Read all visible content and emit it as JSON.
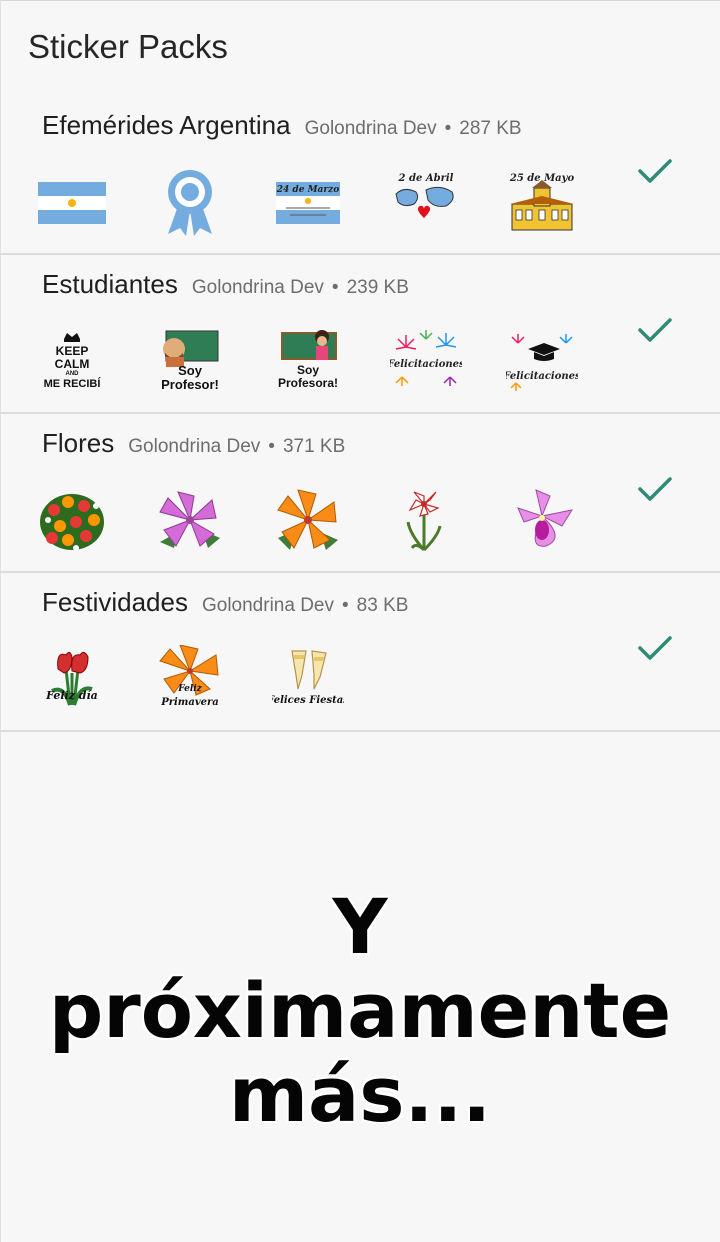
{
  "app": {
    "title": "Sticker Packs"
  },
  "packs": [
    {
      "name": "Efemérides Argentina",
      "publisher": "Golondrina Dev",
      "size": "287 KB",
      "stickers": [
        "argentina-flag",
        "escarapela-rosette",
        "flag-24-de-marzo",
        "malvinas-2-de-abril",
        "cabildo-25-de-mayo"
      ],
      "sticker_texts": {
        "flag_date": "24 de Marzo",
        "malvinas": "2 de Abril",
        "cabildo": "25 de Mayo"
      }
    },
    {
      "name": "Estudiantes",
      "publisher": "Golondrina Dev",
      "size": "239 KB",
      "stickers": [
        "keep-calm-me-recibi",
        "soy-profesor",
        "soy-profesora",
        "felicitaciones-fireworks",
        "felicitaciones-graduation"
      ],
      "sticker_texts": {
        "keep1": "KEEP",
        "keep2": "CALM",
        "keep3": "AND",
        "keep4": "ME RECIBÍ",
        "prof1": "Soy",
        "prof2": "Profesor!",
        "profa1": "Soy",
        "profa2": "Profesora!",
        "felic": "Felicitaciones"
      }
    },
    {
      "name": "Flores",
      "publisher": "Golondrina Dev",
      "size": "371 KB",
      "stickers": [
        "flower-bouquet",
        "pink-azalea",
        "orange-azalea",
        "amaryllis",
        "orchid"
      ]
    },
    {
      "name": "Festividades",
      "publisher": "Golondrina Dev",
      "size": "83 KB",
      "stickers": [
        "feliz-dia-tulips",
        "feliz-primavera",
        "felices-fiestas-champagne"
      ],
      "sticker_texts": {
        "dia": "Feliz día",
        "prim1": "Feliz",
        "prim2": "Primavera",
        "fiestas": "Felices Fiestas"
      }
    }
  ],
  "colors": {
    "check": "#2f8a78",
    "divider": "#dcdcdc",
    "flag_blue": "#74acdf",
    "sun": "#f6b40e"
  },
  "icons": {
    "added": "check-icon"
  },
  "promo": {
    "line1": "Y",
    "line2": "próximamente",
    "line3": "más..."
  }
}
